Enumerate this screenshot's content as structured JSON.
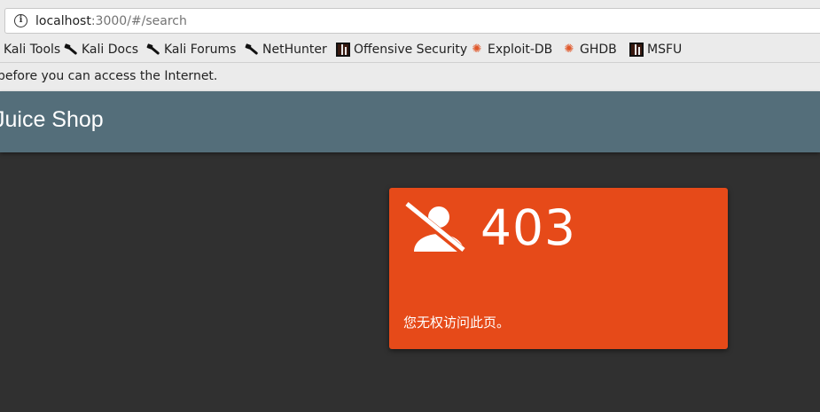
{
  "browser": {
    "url_host": "localhost",
    "url_rest": ":3000/#/search",
    "bookmarks": [
      {
        "label": "Kali Tools",
        "icon": "kali-dragon-icon"
      },
      {
        "label": "Kali Docs",
        "icon": "kali-dragon-icon"
      },
      {
        "label": "Kali Forums",
        "icon": "kali-dragon-icon"
      },
      {
        "label": "NetHunter",
        "icon": "kali-dragon-icon"
      },
      {
        "label": "Offensive Security",
        "icon": "offsec-icon"
      },
      {
        "label": "Exploit-DB",
        "icon": "exploit-db-icon"
      },
      {
        "label": "GHDB",
        "icon": "exploit-db-icon"
      },
      {
        "label": "MSFU",
        "icon": "offsec-icon"
      }
    ],
    "notice": "before you can access the Internet."
  },
  "app": {
    "title": "Juice Shop",
    "toolbar_color": "#546e7a",
    "background_color": "#303030"
  },
  "error": {
    "code": "403",
    "message": "您无权访问此页。",
    "icon": "no-user-icon",
    "card_color": "#e64a19"
  }
}
